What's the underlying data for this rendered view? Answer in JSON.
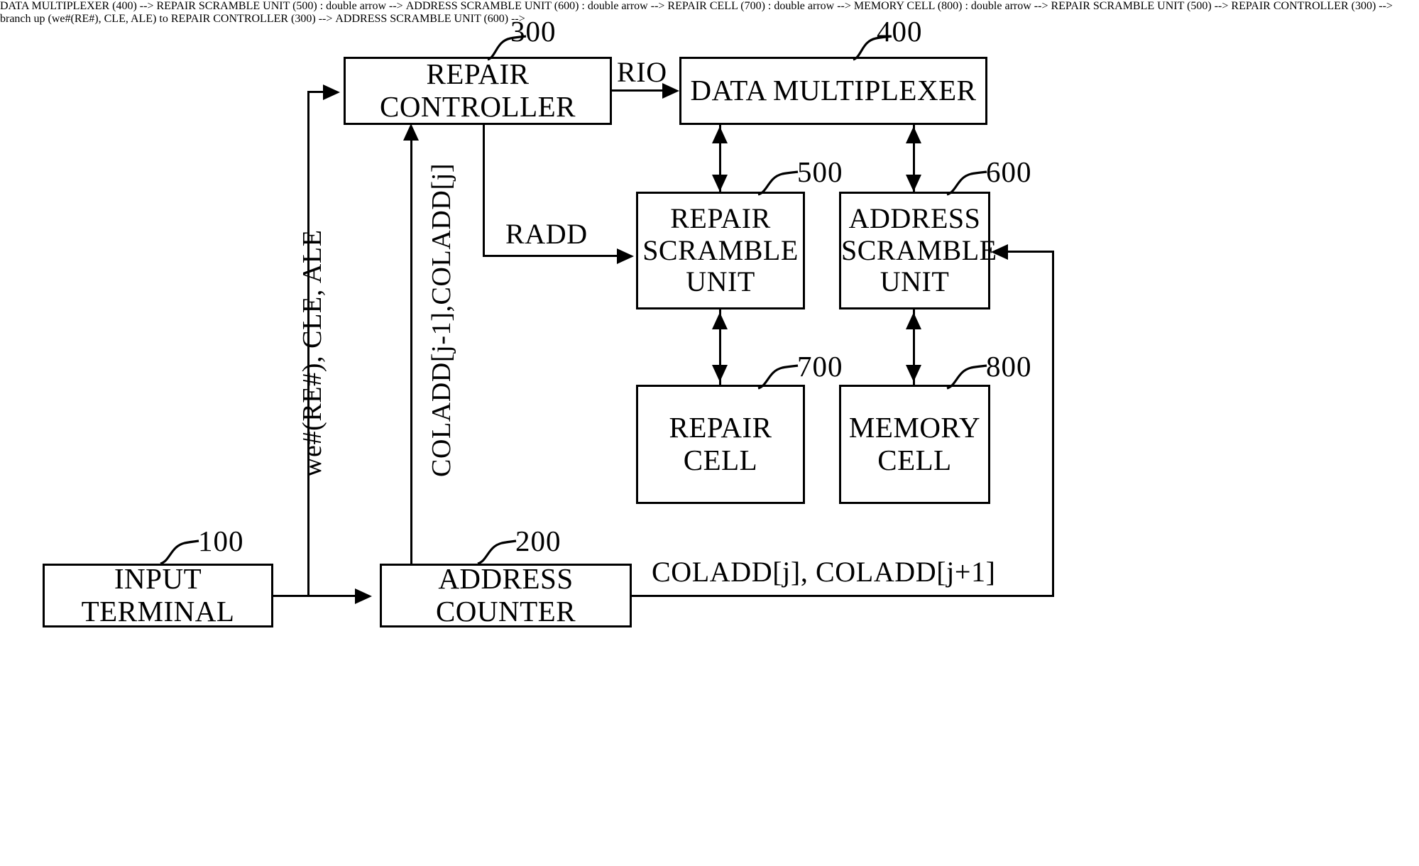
{
  "figure": {
    "type": "patent-block-diagram",
    "background_color": "#ffffff",
    "line_color": "#000000"
  },
  "blocks": {
    "input_terminal": {
      "label": "INPUT TERMINAL",
      "ref": "100"
    },
    "address_counter": {
      "label": "ADDRESS COUNTER",
      "ref": "200"
    },
    "repair_controller": {
      "label": "REPAIR CONTROLLER",
      "ref": "300"
    },
    "data_multiplexer": {
      "label": "DATA MULTIPLEXER",
      "ref": "400"
    },
    "repair_scramble_unit": {
      "label": "REPAIR\nSCRAMBLE\nUNIT",
      "ref": "500"
    },
    "address_scramble_unit": {
      "label": "ADDRESS\nSCRAMBLE\nUNIT",
      "ref": "600"
    },
    "repair_cell": {
      "label": "REPAIR\nCELL",
      "ref": "700"
    },
    "memory_cell": {
      "label": "MEMORY\nCELL",
      "ref": "800"
    }
  },
  "signals": {
    "rio": "RIO",
    "radd": "RADD",
    "control_bus": "we#(RE#), CLE, ALE",
    "coladd_pair": "COLADD[j-1],COLADD[j]",
    "coladd_out": "COLADD[j], COLADD[j+1]"
  }
}
